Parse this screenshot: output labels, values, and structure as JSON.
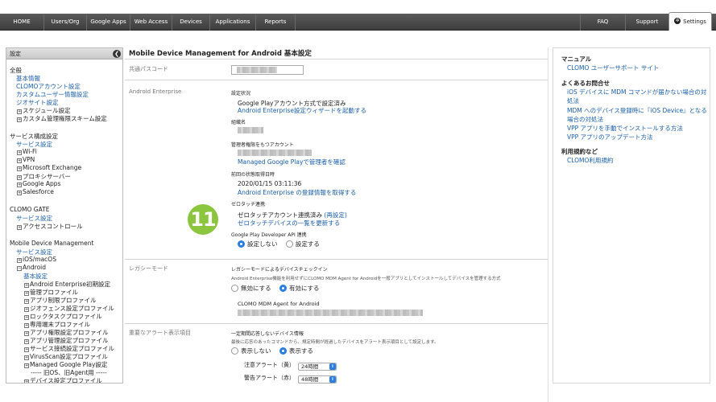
{
  "topnav": {
    "left": [
      "HOME",
      "Users/Org",
      "Google Apps",
      "Web Access",
      "Devices",
      "Applications",
      "Reports"
    ],
    "faq": "FAQ",
    "support": "Support",
    "settings": "Settings"
  },
  "sidebar": {
    "header": "設定",
    "general": {
      "title": "全般",
      "links": [
        "基本情報",
        "CLOMOアカウント設定",
        "カスタムユーザー情報設定",
        "ジオサイト設定"
      ],
      "items": [
        "スケジュール設定",
        "カスタム管理権限スキーム設定"
      ]
    },
    "service": {
      "title": "サービス構成設定",
      "link": "サービス設定",
      "items": [
        "Wi-Fi",
        "VPN",
        "Microsoft Exchange",
        "プロキシサーバー",
        "Google Apps",
        "Salesforce"
      ]
    },
    "gate": {
      "title": "CLOMO GATE",
      "link": "サービス設定",
      "item": "アクセスコントロール"
    },
    "mdm": {
      "title": "Mobile Device Management",
      "link": "サービス設定",
      "ios": "iOS/macOS",
      "android": "Android",
      "android_basic": "基本設定",
      "android_items": [
        "Android Enterprise初期設定",
        "管理プロファイル",
        "アプリ制限プロファイル",
        "ジオフェンス設定プロファイル",
        "ロックタスクプロファイル",
        "専用端末プロファイル",
        "アプリ権限設定プロファイル",
        "アプリ管理設定プロファイル",
        "サービス接続設定プロファイル",
        "VirusScan設定プロファイル",
        "Managed Google Play設定"
      ],
      "legacy_divider": "----- 旧OS、旧Agent用 -----",
      "last_item": "デバイス設定プロファイル"
    }
  },
  "main": {
    "title": "Mobile Device Management for Android 基本設定",
    "passcode_label": "共通パスコード",
    "ae_label": "Android Enterprise",
    "setup_status_label": "設定状況",
    "setup_status_value": "Google Playアカウント方式で設定済み",
    "setup_wizard_link": "Android Enterprise設定ウィザードを起動する",
    "org_name_label": "組織名",
    "admin_account_label": "管理者権限をもつアカウント",
    "managed_play_link": "Managed Google Playで管理者を確認",
    "last_status_label": "前回の状態取得日時",
    "last_status_value": "2020/01/15 03:11:36",
    "registration_link": "Android Enterprise の登録情報を取得する",
    "zero_touch_label": "ゼロタッチ連携",
    "zero_touch_status": "ゼロタッチアカウント連携済み",
    "zero_touch_reset": "(再設定)",
    "zero_touch_update": "ゼロタッチデバイスの一覧を更新する",
    "gp_api_label": "Google Play Developer API 連携",
    "gp_api_options": [
      "設定しない",
      "設定する"
    ],
    "gp_api_selected": "設定しない",
    "legacy_label": "レガシーモード",
    "legacy_kitting_label": "レガシーモードによるデバイスチェックイン",
    "legacy_desc": "Android Enterprise機能を利用せずにCLOMO MDM Agent for Androidを一般アプリとしてインストールしてデバイスを管理する方式",
    "legacy_options": [
      "無効にする",
      "有効にする"
    ],
    "legacy_selected": "有効にする",
    "agent_label": "CLOMO MDM Agent for Android",
    "alert_label": "重要なアラート表示項目",
    "alert_title": "一定期間応答しないデバイス情報",
    "alert_desc": "最後に応答のあったコマンドから、規定時間が経過したデバイスをアラート表示項目として設定します。",
    "alert_options": [
      "表示しない",
      "表示する"
    ],
    "alert_selected": "表示する",
    "caution_label": "注意アラート（黄）",
    "caution_value": "24時間",
    "warning_label": "警告アラート（赤）",
    "warning_value": "48時間",
    "step_number": "11"
  },
  "rightpanel": {
    "manual_title": "マニュアル",
    "manual_link": "CLOMO ユーザーサポート サイト",
    "faq_title": "よくあるお問合せ",
    "faq_links": [
      "iOS デバイスに MDM コマンドが届かない場合の対処法",
      "MDM へのデバイス登録時に『iOS Device』となる場合の対処法",
      "VPP アプリを手動でインストールする方法",
      "VPP アプリのアップデート方法"
    ],
    "terms_title": "利用規約など",
    "terms_link": "CLOMO利用規約"
  },
  "colors": {
    "nav_bg": "#4a4a4a",
    "link": "#1a5ea8",
    "radio_on": "#2a7de1",
    "step_badge": "#8cc63f"
  }
}
